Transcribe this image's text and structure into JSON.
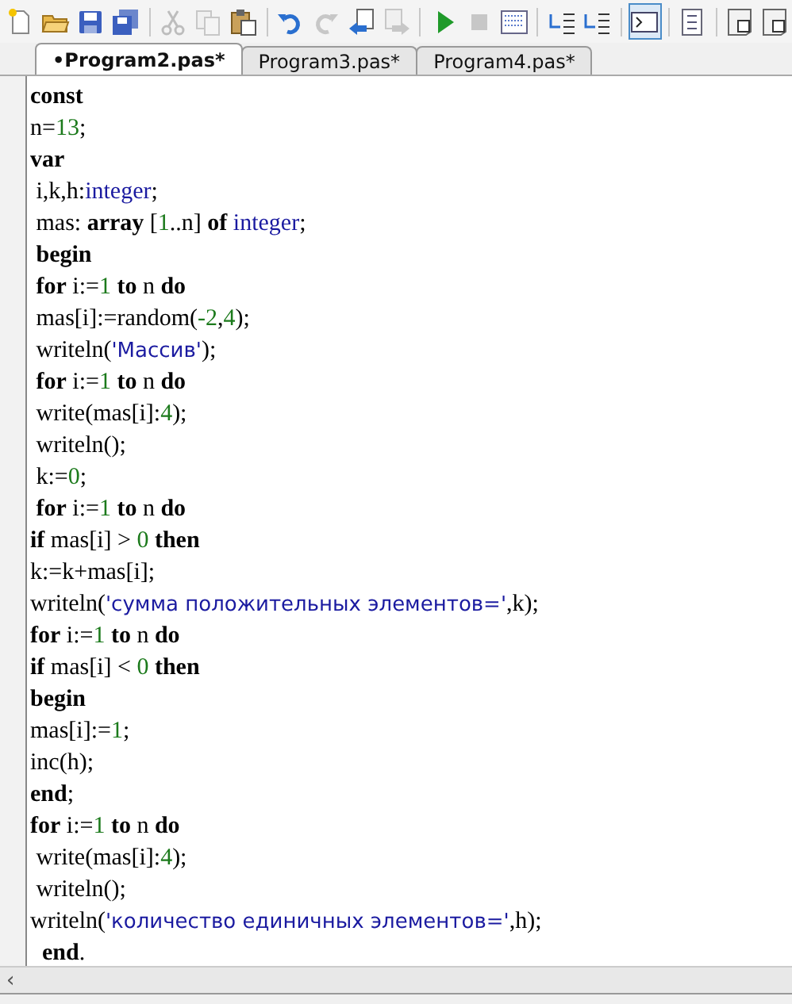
{
  "toolbar": [
    {
      "kind": "new",
      "disabled": false,
      "pressed": false
    },
    {
      "kind": "open",
      "disabled": false,
      "pressed": false
    },
    {
      "kind": "save",
      "disabled": false,
      "pressed": false
    },
    {
      "kind": "save-all",
      "disabled": false,
      "pressed": false
    },
    {
      "kind": "separator"
    },
    {
      "kind": "cut",
      "disabled": true,
      "pressed": false
    },
    {
      "kind": "copy",
      "disabled": true,
      "pressed": false
    },
    {
      "kind": "paste",
      "disabled": false,
      "pressed": false
    },
    {
      "kind": "separator"
    },
    {
      "kind": "undo",
      "disabled": false,
      "pressed": false
    },
    {
      "kind": "redo",
      "disabled": true,
      "pressed": false
    },
    {
      "kind": "back",
      "disabled": false,
      "pressed": false
    },
    {
      "kind": "forward",
      "disabled": true,
      "pressed": false
    },
    {
      "kind": "separator"
    },
    {
      "kind": "run",
      "disabled": false,
      "pressed": false
    },
    {
      "kind": "stop",
      "disabled": true,
      "pressed": false
    },
    {
      "kind": "debug",
      "disabled": false,
      "pressed": false
    },
    {
      "kind": "separator"
    },
    {
      "kind": "indent",
      "disabled": false,
      "pressed": false
    },
    {
      "kind": "outdent",
      "disabled": false,
      "pressed": false
    },
    {
      "kind": "separator"
    },
    {
      "kind": "console",
      "disabled": false,
      "pressed": true
    },
    {
      "kind": "separator"
    },
    {
      "kind": "list",
      "disabled": false,
      "pressed": false
    },
    {
      "kind": "separator"
    },
    {
      "kind": "doc-d",
      "disabled": false,
      "pressed": false
    },
    {
      "kind": "doc-l",
      "disabled": false,
      "pressed": false
    }
  ],
  "tabs": [
    {
      "label": "•Program2.pas*",
      "selected": true
    },
    {
      "label": "Program3.pas*",
      "selected": false
    },
    {
      "label": "Program4.pas*",
      "selected": false
    }
  ],
  "code": [
    [
      {
        "text": "const",
        "kind": "kw"
      }
    ],
    [
      {
        "text": "n=",
        "kind": "plain"
      },
      {
        "text": "13",
        "kind": "num"
      },
      {
        "text": ";",
        "kind": "plain"
      }
    ],
    [
      {
        "text": "var",
        "kind": "kw"
      }
    ],
    [
      {
        "text": " i,k,h:",
        "kind": "plain"
      },
      {
        "text": "integer",
        "kind": "type"
      },
      {
        "text": ";",
        "kind": "plain"
      }
    ],
    [
      {
        "text": " mas: ",
        "kind": "plain"
      },
      {
        "text": "array",
        "kind": "kw"
      },
      {
        "text": " [",
        "kind": "plain"
      },
      {
        "text": "1",
        "kind": "num"
      },
      {
        "text": "..n] ",
        "kind": "plain"
      },
      {
        "text": "of",
        "kind": "kw"
      },
      {
        "text": " integer",
        "kind": "type"
      },
      {
        "text": ";",
        "kind": "plain"
      }
    ],
    [
      {
        "text": " begin",
        "kind": "kw"
      }
    ],
    [
      {
        "text": " for",
        "kind": "kw"
      },
      {
        "text": " i:=",
        "kind": "plain"
      },
      {
        "text": "1",
        "kind": "num"
      },
      {
        "text": " to",
        "kind": "kw"
      },
      {
        "text": " n ",
        "kind": "plain"
      },
      {
        "text": "do",
        "kind": "kw"
      }
    ],
    [
      {
        "text": " mas[i]:=random(",
        "kind": "plain"
      },
      {
        "text": "-2",
        "kind": "num"
      },
      {
        "text": ",",
        "kind": "plain"
      },
      {
        "text": "4",
        "kind": "num"
      },
      {
        "text": ");",
        "kind": "plain"
      }
    ],
    [
      {
        "text": " writeln(",
        "kind": "plain"
      },
      {
        "text": "'Массив'",
        "kind": "str"
      },
      {
        "text": ");",
        "kind": "plain"
      }
    ],
    [
      {
        "text": " for",
        "kind": "kw"
      },
      {
        "text": " i:=",
        "kind": "plain"
      },
      {
        "text": "1",
        "kind": "num"
      },
      {
        "text": " to",
        "kind": "kw"
      },
      {
        "text": " n ",
        "kind": "plain"
      },
      {
        "text": "do",
        "kind": "kw"
      }
    ],
    [
      {
        "text": " write(mas[i]:",
        "kind": "plain"
      },
      {
        "text": "4",
        "kind": "num"
      },
      {
        "text": ");",
        "kind": "plain"
      }
    ],
    [
      {
        "text": " writeln();",
        "kind": "plain"
      }
    ],
    [
      {
        "text": " k:=",
        "kind": "plain"
      },
      {
        "text": "0",
        "kind": "num"
      },
      {
        "text": ";",
        "kind": "plain"
      }
    ],
    [
      {
        "text": " for",
        "kind": "kw"
      },
      {
        "text": " i:=",
        "kind": "plain"
      },
      {
        "text": "1",
        "kind": "num"
      },
      {
        "text": " to",
        "kind": "kw"
      },
      {
        "text": " n ",
        "kind": "plain"
      },
      {
        "text": "do",
        "kind": "kw"
      }
    ],
    [
      {
        "text": "if",
        "kind": "kw"
      },
      {
        "text": " mas[i] > ",
        "kind": "plain"
      },
      {
        "text": "0",
        "kind": "num"
      },
      {
        "text": " then",
        "kind": "kw"
      }
    ],
    [
      {
        "text": "k:=k+mas[i];",
        "kind": "plain"
      }
    ],
    [
      {
        "text": "writeln(",
        "kind": "plain"
      },
      {
        "text": "'сумма положительных элементов='",
        "kind": "str"
      },
      {
        "text": ",k);",
        "kind": "plain"
      }
    ],
    [
      {
        "text": "for",
        "kind": "kw"
      },
      {
        "text": " i:=",
        "kind": "plain"
      },
      {
        "text": "1",
        "kind": "num"
      },
      {
        "text": " to",
        "kind": "kw"
      },
      {
        "text": " n ",
        "kind": "plain"
      },
      {
        "text": "do",
        "kind": "kw"
      }
    ],
    [
      {
        "text": "if",
        "kind": "kw"
      },
      {
        "text": " mas[i] < ",
        "kind": "plain"
      },
      {
        "text": "0",
        "kind": "num"
      },
      {
        "text": " then",
        "kind": "kw"
      }
    ],
    [
      {
        "text": "begin",
        "kind": "kw"
      }
    ],
    [
      {
        "text": "mas[i]:=",
        "kind": "plain"
      },
      {
        "text": "1",
        "kind": "num"
      },
      {
        "text": ";",
        "kind": "plain"
      }
    ],
    [
      {
        "text": "inc(h);",
        "kind": "plain"
      }
    ],
    [
      {
        "text": "end",
        "kind": "kw"
      },
      {
        "text": ";",
        "kind": "plain"
      }
    ],
    [
      {
        "text": "for",
        "kind": "kw"
      },
      {
        "text": " i:=",
        "kind": "plain"
      },
      {
        "text": "1",
        "kind": "num"
      },
      {
        "text": " to",
        "kind": "kw"
      },
      {
        "text": " n ",
        "kind": "plain"
      },
      {
        "text": "do",
        "kind": "kw"
      }
    ],
    [
      {
        "text": " write(mas[i]:",
        "kind": "plain"
      },
      {
        "text": "4",
        "kind": "num"
      },
      {
        "text": ");",
        "kind": "plain"
      }
    ],
    [
      {
        "text": " writeln();",
        "kind": "plain"
      }
    ],
    [
      {
        "text": "writeln(",
        "kind": "plain"
      },
      {
        "text": "'количество единичных элементов='",
        "kind": "str"
      },
      {
        "text": ",h);",
        "kind": "plain"
      }
    ],
    [
      {
        "text": "  end",
        "kind": "kw"
      },
      {
        "text": ".",
        "kind": "plain"
      }
    ]
  ],
  "scrollbar": {
    "left_arrow": "‹"
  }
}
